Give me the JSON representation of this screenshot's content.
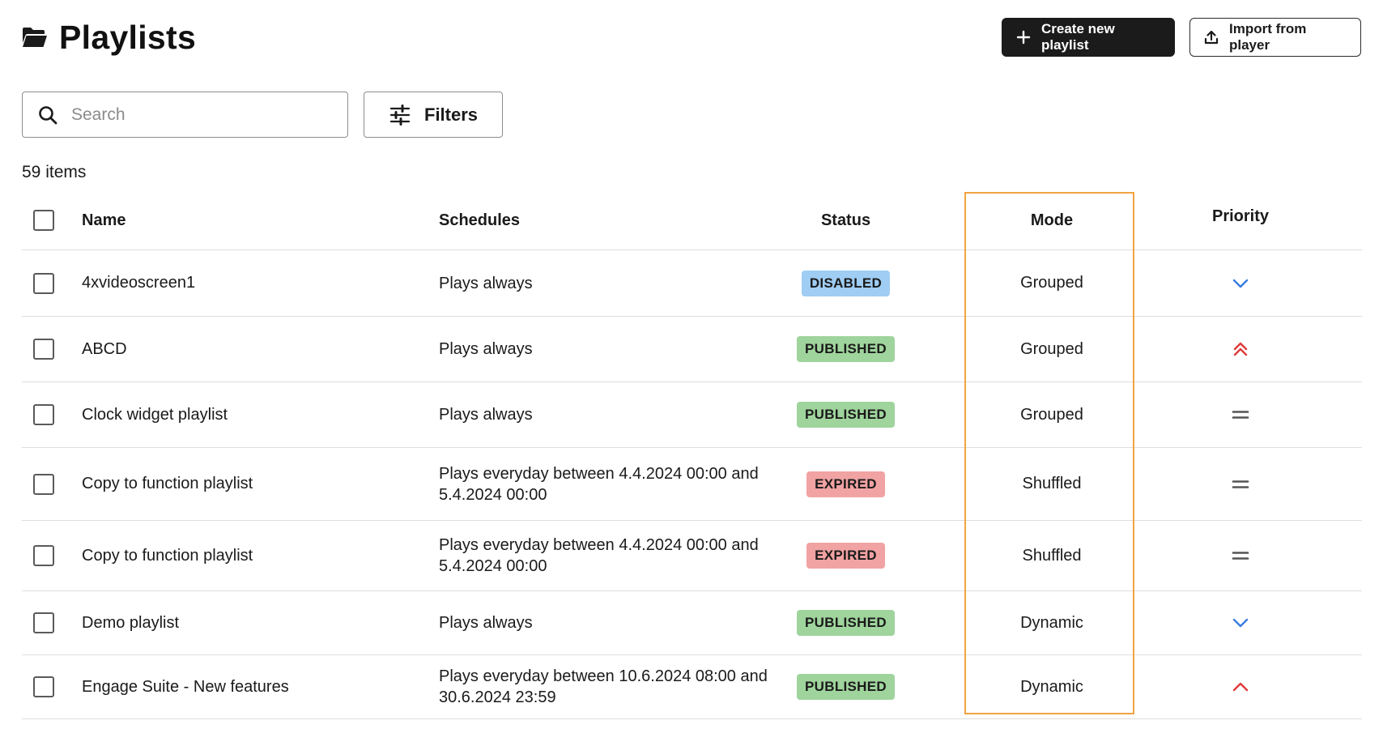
{
  "header": {
    "title": "Playlists",
    "title_icon": "folder-open-icon",
    "create_button_label": "Create new playlist",
    "import_button_label": "Import from player"
  },
  "toolbar": {
    "search_placeholder": "Search",
    "search_value": "",
    "filters_label": "Filters"
  },
  "item_count": "59 items",
  "table": {
    "columns": {
      "name": "Name",
      "schedules": "Schedules",
      "status": "Status",
      "mode": "Mode",
      "priority": "Priority"
    },
    "rows": [
      {
        "name": "4xvideoscreen1",
        "schedule": "Plays always",
        "status": "DISABLED",
        "status_color": "#9fcdf3",
        "mode": "Grouped",
        "priority": "low",
        "priority_icon": "chevron-down-icon"
      },
      {
        "name": "ABCD",
        "schedule": "Plays always",
        "status": "PUBLISHED",
        "status_color": "#9fd49c",
        "mode": "Grouped",
        "priority": "highest",
        "priority_icon": "double-chevron-up-icon"
      },
      {
        "name": "Clock widget playlist",
        "schedule": "Plays always",
        "status": "PUBLISHED",
        "status_color": "#9fd49c",
        "mode": "Grouped",
        "priority": "medium",
        "priority_icon": "equals-icon"
      },
      {
        "name": "Copy to function playlist",
        "schedule": "Plays everyday between 4.4.2024 00:00 and 5.4.2024 00:00",
        "status": "EXPIRED",
        "status_color": "#f1a2a2",
        "mode": "Shuffled",
        "priority": "medium",
        "priority_icon": "equals-icon"
      },
      {
        "name": "Copy to function playlist",
        "schedule": "Plays everyday between 4.4.2024 00:00 and 5.4.2024 00:00",
        "status": "EXPIRED",
        "status_color": "#f1a2a2",
        "mode": "Shuffled",
        "priority": "medium",
        "priority_icon": "equals-icon"
      },
      {
        "name": "Demo playlist",
        "schedule": "Plays always",
        "status": "PUBLISHED",
        "status_color": "#9fd49c",
        "mode": "Dynamic",
        "priority": "low",
        "priority_icon": "chevron-down-icon"
      },
      {
        "name": "Engage Suite - New features",
        "schedule": "Plays everyday between 10.6.2024 08:00 and 30.6.2024 23:59",
        "status": "PUBLISHED",
        "status_color": "#9fd49c",
        "mode": "Dynamic",
        "priority": "high",
        "priority_icon": "chevron-up-icon"
      }
    ]
  },
  "colors": {
    "primary_button": "#1b1b1b",
    "highlight_outline": "#f2a242",
    "priority_low": "#3a7de0",
    "priority_high": "#e03a3a",
    "priority_medium": "#555555"
  }
}
